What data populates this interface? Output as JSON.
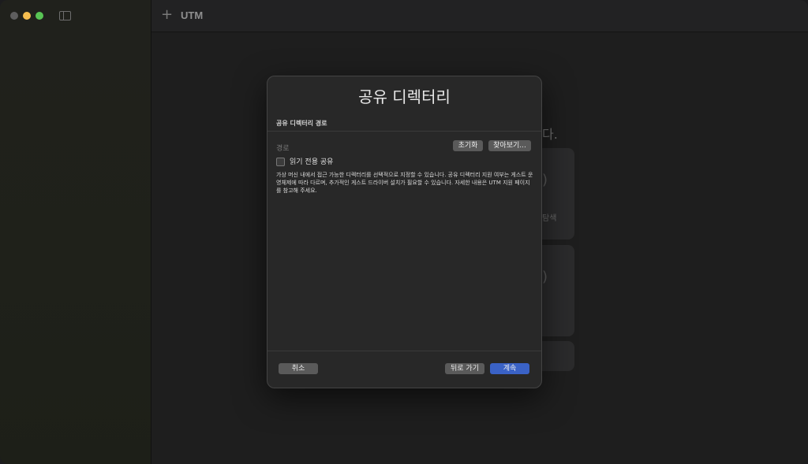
{
  "app": {
    "title": "UTM"
  },
  "background": {
    "partial_text": "다.",
    "card1_label": "탐색"
  },
  "dialog": {
    "title": "공유 디렉터리",
    "section_header": "공유 디렉터리 경로",
    "path_label": "경로",
    "reset_button": "초기화",
    "browse_button": "찾아보기...",
    "read_only_label": "읽기 전용 공유",
    "read_only_checked": false,
    "description": "가상 머신 내에서 접근 가능한 디렉터리를 선택적으로 지정할 수 있습니다. 공유 디렉터리 지원 여부는 게스트 운영체제에 따라 다르며, 추가적인 게스트 드라이버 설치가 필요할 수 있습니다. 자세한 내용은 UTM 지원 페이지를 참고해 주세요.",
    "cancel_button": "취소",
    "back_button": "뒤로 가기",
    "continue_button": "계속"
  },
  "colors": {
    "accent": "#3a62c6",
    "traffic_close": "#5e5e5e",
    "traffic_minimize": "#f5bd4f",
    "traffic_maximize": "#58c454"
  }
}
